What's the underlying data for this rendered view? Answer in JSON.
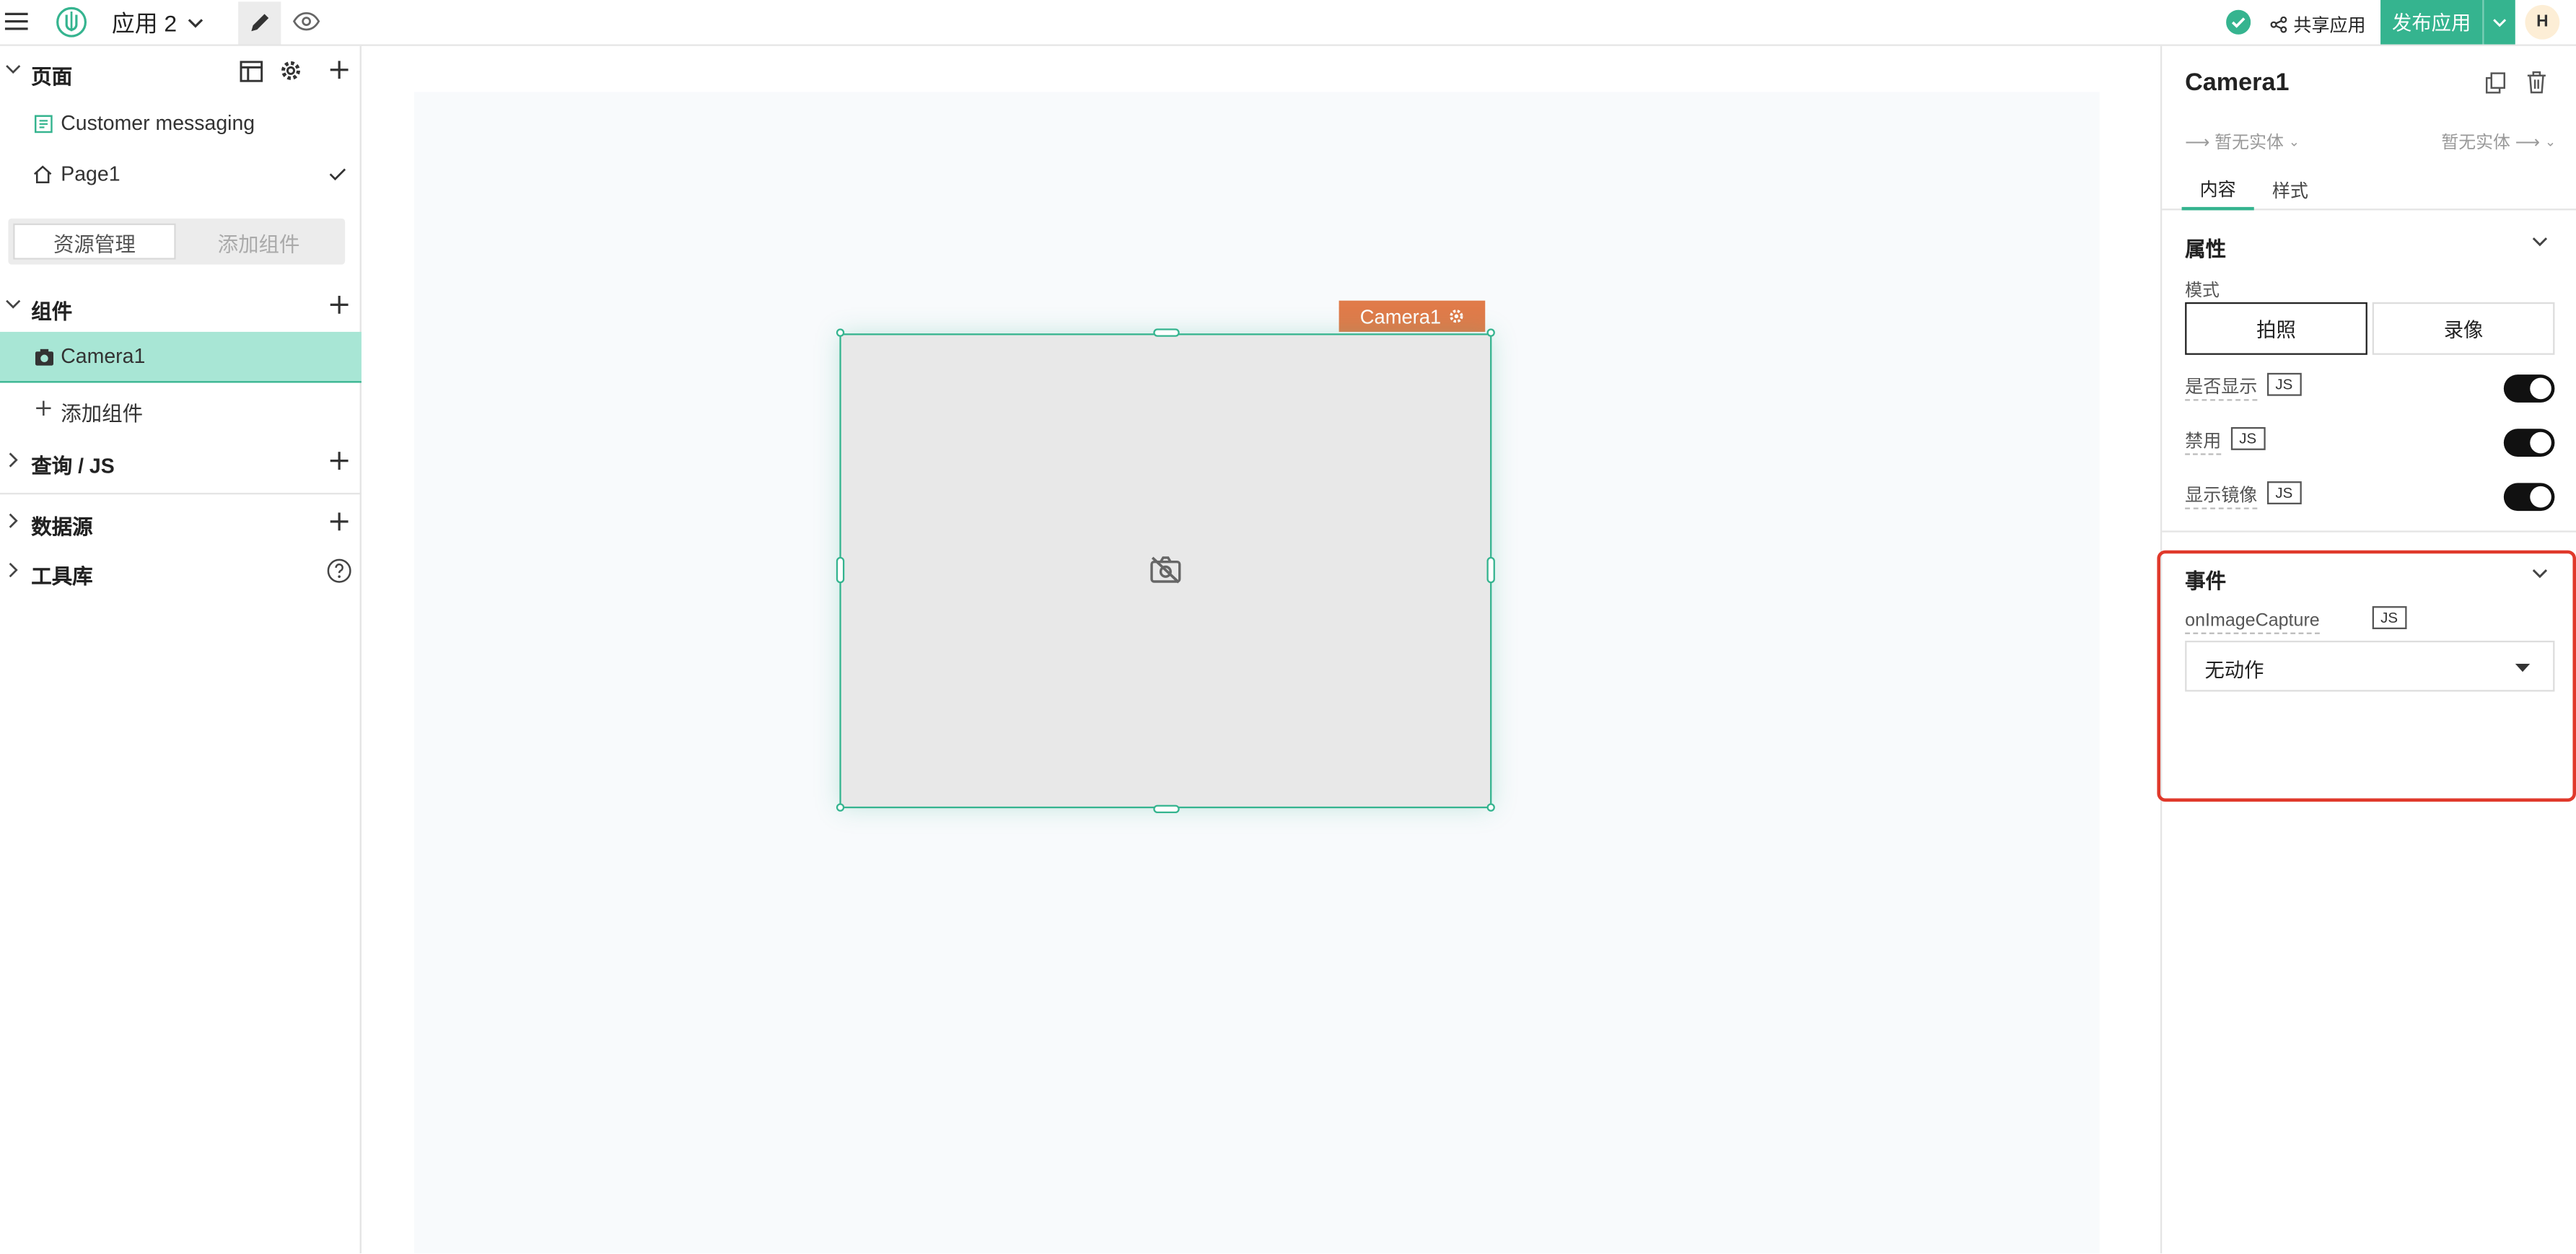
{
  "topbar": {
    "app_name": "应用 2",
    "share_label": "共享应用",
    "publish_label": "发布应用",
    "avatar_initial": "H"
  },
  "left": {
    "pages_title": "页面",
    "pages": [
      {
        "label": "Customer messaging",
        "icon": "page-template-icon"
      },
      {
        "label": "Page1",
        "icon": "home-icon"
      }
    ],
    "tabs": [
      "资源管理",
      "添加组件"
    ],
    "widgets_title": "组件",
    "widgets": [
      {
        "label": "Camera1",
        "icon": "camera-icon"
      }
    ],
    "add_widget_label": "添加组件",
    "sections": [
      "查询 / JS",
      "数据源",
      "工具库"
    ]
  },
  "canvas": {
    "widget_label": "Camera1"
  },
  "right": {
    "title": "Camera1",
    "entity_left": "暂无实体",
    "entity_right": "暂无实体",
    "tabs": [
      "内容",
      "样式"
    ],
    "props_title": "属性",
    "mode_label": "模式",
    "mode_options": [
      "拍照",
      "录像"
    ],
    "toggles": [
      "是否显示",
      "禁用",
      "显示镜像"
    ],
    "js_badge": "JS",
    "events_title": "事件",
    "event_name": "onImageCapture",
    "action_value": "无动作"
  },
  "colors": {
    "accent": "#35b48f",
    "selected_bg": "#a8e6d5",
    "camera_tag": "#e07b4a",
    "highlight": "#e0392b"
  }
}
